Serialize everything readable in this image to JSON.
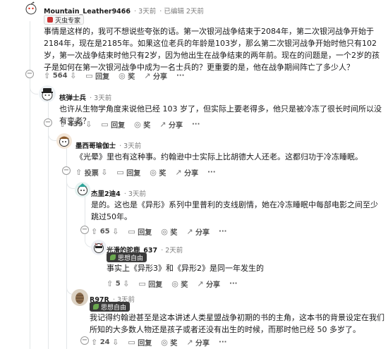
{
  "comments": [
    {
      "author": "Mountain_Leather9466",
      "time": "3天前",
      "edited": "已编辑 2天前",
      "flair": "灭虫专家",
      "body": "事情是这样的，我可不想说些夸张的话。第一次银河战争结束于2084年，第二次银河战争开始于2184年，现在是2185年。如果这位老兵的年龄是103岁，那么第二次银河战争开始时他只有102岁，第一次战争结束时他只有2岁，因为他出生在战争结束的两年前。现在的问题是，一个2岁的孩子是如何在第一次银河战争中成为一名士兵的？更重要的是，他在战争期间阵亡了多少人？",
      "votes": "564"
    },
    {
      "author": "核弹士兵",
      "time": "3天前",
      "body": "也许从生物学角度来说他已经 103 岁了，但实际上要老得多，他只是被冷冻了很长时间所以没有变老？",
      "votes": "439"
    },
    {
      "author": "墨西哥瑜伽士",
      "time": "3天前",
      "body": "《光晕》里也有这种事。约翰逊中士实际上比胡德大人还老。这都归功于冷冻睡眠。",
      "votes": "投票"
    },
    {
      "author": "杰里2迪4",
      "time": "3天前",
      "body": "是的。这也是《异形》系列中里普利的支线剧情，她在冷冻睡眠中每部电影之间至少跳过50年。",
      "votes": "65"
    },
    {
      "author": "光滑的驼鹿_637",
      "time": "2天前",
      "flair": "思想自由",
      "body": "事实上《异形3》和《异形2》是同一年发生的",
      "votes": "5"
    },
    {
      "author": "R97R",
      "time": "3天前",
      "flair": "思想自由",
      "body": "我记得约翰逊甚至是这本讲述人类星盟战争初期的书的主角，这本书的背景设定在我们所知的大多数人物还是孩子或者还没有出生的时候，而那时他已经 50 多岁了。",
      "votes": "24"
    }
  ],
  "actions": {
    "reply": "回复",
    "award": "奖",
    "share": "分享",
    "more": "···"
  }
}
